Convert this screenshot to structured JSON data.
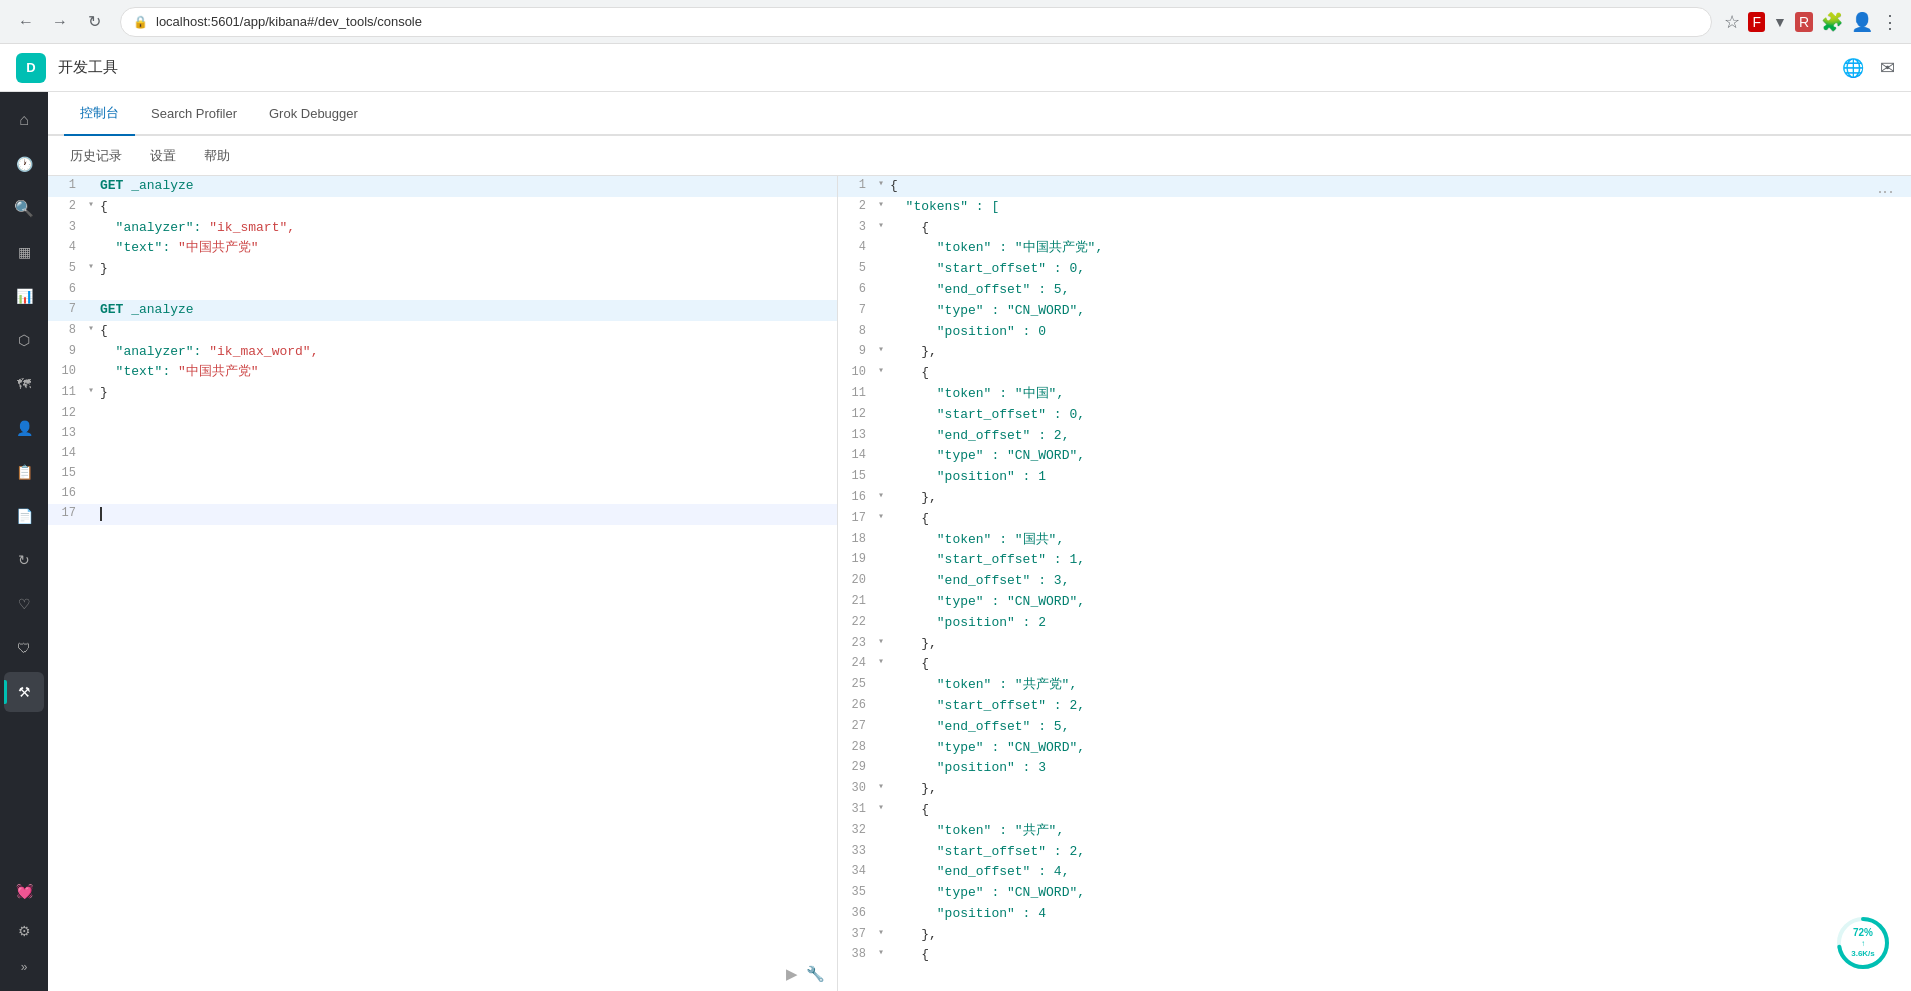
{
  "browser": {
    "url": "localhost:5601/app/kibana#/dev_tools/console",
    "nav_back": "←",
    "nav_forward": "→",
    "nav_refresh": "↻"
  },
  "appbar": {
    "logo_text": "D",
    "title": "开发工具"
  },
  "tabs": [
    {
      "id": "console",
      "label": "控制台",
      "active": true
    },
    {
      "id": "search-profiler",
      "label": "Search Profiler",
      "active": false
    },
    {
      "id": "grok-debugger",
      "label": "Grok Debugger",
      "active": false
    }
  ],
  "toolbar": {
    "history": "历史记录",
    "settings": "设置",
    "help": "帮助"
  },
  "left_editor": {
    "lines": [
      {
        "num": 1,
        "arrow": "",
        "code": "GET _analyze",
        "class": "green"
      },
      {
        "num": 2,
        "arrow": "▾",
        "code": "{",
        "class": ""
      },
      {
        "num": 3,
        "arrow": "",
        "code": "  \"analyzer\": \"ik_smart\",",
        "class": "mixed"
      },
      {
        "num": 4,
        "arrow": "",
        "code": "  \"text\": \"中国共产党\"",
        "class": "mixed"
      },
      {
        "num": 5,
        "arrow": "▾",
        "code": "}",
        "class": ""
      },
      {
        "num": 6,
        "arrow": "",
        "code": "",
        "class": ""
      },
      {
        "num": 7,
        "arrow": "",
        "code": "GET _analyze",
        "class": "green"
      },
      {
        "num": 8,
        "arrow": "▾",
        "code": "{",
        "class": ""
      },
      {
        "num": 9,
        "arrow": "",
        "code": "  \"analyzer\": \"ik_max_word\",",
        "class": "mixed"
      },
      {
        "num": 10,
        "arrow": "",
        "code": "  \"text\": \"中国共产党\"",
        "class": "mixed"
      },
      {
        "num": 11,
        "arrow": "▾",
        "code": "}",
        "class": ""
      },
      {
        "num": 12,
        "arrow": "",
        "code": "",
        "class": ""
      },
      {
        "num": 13,
        "arrow": "",
        "code": "",
        "class": ""
      },
      {
        "num": 14,
        "arrow": "",
        "code": "",
        "class": ""
      },
      {
        "num": 15,
        "arrow": "",
        "code": "",
        "class": ""
      },
      {
        "num": 16,
        "arrow": "",
        "code": "",
        "class": ""
      },
      {
        "num": 17,
        "arrow": "",
        "code": "",
        "class": "cursor"
      }
    ],
    "action_run": "▶",
    "action_wrench": "🔧"
  },
  "right_panel": {
    "lines": [
      {
        "num": 1,
        "arrow": "▾",
        "highlighted": true,
        "parts": [
          {
            "text": "{",
            "color": "#333"
          }
        ]
      },
      {
        "num": 2,
        "arrow": "▾",
        "parts": [
          {
            "text": "  \"tokens\" : [",
            "color": "#007f6e"
          }
        ]
      },
      {
        "num": 3,
        "arrow": "▾",
        "parts": [
          {
            "text": "    {",
            "color": "#333"
          }
        ]
      },
      {
        "num": 4,
        "arrow": "",
        "parts": [
          {
            "text": "      \"token\" : \"中国共产党\",",
            "color": "#007f6e"
          }
        ]
      },
      {
        "num": 5,
        "arrow": "",
        "parts": [
          {
            "text": "      \"start_offset\" : 0,",
            "color": "#007f6e"
          }
        ]
      },
      {
        "num": 6,
        "arrow": "",
        "parts": [
          {
            "text": "      \"end_offset\" : 5,",
            "color": "#007f6e"
          }
        ]
      },
      {
        "num": 7,
        "arrow": "",
        "parts": [
          {
            "text": "      \"type\" : \"CN_WORD\",",
            "color": "#007f6e"
          }
        ]
      },
      {
        "num": 8,
        "arrow": "",
        "parts": [
          {
            "text": "      \"position\" : 0",
            "color": "#007f6e"
          }
        ]
      },
      {
        "num": 9,
        "arrow": "▾",
        "parts": [
          {
            "text": "    },",
            "color": "#333"
          }
        ]
      },
      {
        "num": 10,
        "arrow": "▾",
        "parts": [
          {
            "text": "    {",
            "color": "#333"
          }
        ]
      },
      {
        "num": 11,
        "arrow": "",
        "parts": [
          {
            "text": "      \"token\" : \"中国\",",
            "color": "#007f6e"
          }
        ]
      },
      {
        "num": 12,
        "arrow": "",
        "parts": [
          {
            "text": "      \"start_offset\" : 0,",
            "color": "#007f6e"
          }
        ]
      },
      {
        "num": 13,
        "arrow": "",
        "parts": [
          {
            "text": "      \"end_offset\" : 2,",
            "color": "#007f6e"
          }
        ]
      },
      {
        "num": 14,
        "arrow": "",
        "parts": [
          {
            "text": "      \"type\" : \"CN_WORD\",",
            "color": "#007f6e"
          }
        ]
      },
      {
        "num": 15,
        "arrow": "",
        "parts": [
          {
            "text": "      \"position\" : 1",
            "color": "#007f6e"
          }
        ]
      },
      {
        "num": 16,
        "arrow": "▾",
        "parts": [
          {
            "text": "    },",
            "color": "#333"
          }
        ]
      },
      {
        "num": 17,
        "arrow": "▾",
        "parts": [
          {
            "text": "    {",
            "color": "#333"
          }
        ]
      },
      {
        "num": 18,
        "arrow": "",
        "parts": [
          {
            "text": "      \"token\" : \"国共\",",
            "color": "#007f6e"
          }
        ]
      },
      {
        "num": 19,
        "arrow": "",
        "parts": [
          {
            "text": "      \"start_offset\" : 1,",
            "color": "#007f6e"
          }
        ]
      },
      {
        "num": 20,
        "arrow": "",
        "parts": [
          {
            "text": "      \"end_offset\" : 3,",
            "color": "#007f6e"
          }
        ]
      },
      {
        "num": 21,
        "arrow": "",
        "parts": [
          {
            "text": "      \"type\" : \"CN_WORD\",",
            "color": "#007f6e"
          }
        ]
      },
      {
        "num": 22,
        "arrow": "",
        "parts": [
          {
            "text": "      \"position\" : 2",
            "color": "#007f6e"
          }
        ]
      },
      {
        "num": 23,
        "arrow": "▾",
        "parts": [
          {
            "text": "    },",
            "color": "#333"
          }
        ]
      },
      {
        "num": 24,
        "arrow": "▾",
        "parts": [
          {
            "text": "    {",
            "color": "#333"
          }
        ]
      },
      {
        "num": 25,
        "arrow": "",
        "parts": [
          {
            "text": "      \"token\" : \"共产党\",",
            "color": "#007f6e"
          }
        ]
      },
      {
        "num": 26,
        "arrow": "",
        "parts": [
          {
            "text": "      \"start_offset\" : 2,",
            "color": "#007f6e"
          }
        ]
      },
      {
        "num": 27,
        "arrow": "",
        "parts": [
          {
            "text": "      \"end_offset\" : 5,",
            "color": "#007f6e"
          }
        ]
      },
      {
        "num": 28,
        "arrow": "",
        "parts": [
          {
            "text": "      \"type\" : \"CN_WORD\",",
            "color": "#007f6e"
          }
        ]
      },
      {
        "num": 29,
        "arrow": "",
        "parts": [
          {
            "text": "      \"position\" : 3",
            "color": "#007f6e"
          }
        ]
      },
      {
        "num": 30,
        "arrow": "▾",
        "parts": [
          {
            "text": "    },",
            "color": "#333"
          }
        ]
      },
      {
        "num": 31,
        "arrow": "▾",
        "parts": [
          {
            "text": "    {",
            "color": "#333"
          }
        ]
      },
      {
        "num": 32,
        "arrow": "",
        "parts": [
          {
            "text": "      \"token\" : \"共产\",",
            "color": "#007f6e"
          }
        ]
      },
      {
        "num": 33,
        "arrow": "",
        "parts": [
          {
            "text": "      \"start_offset\" : 2,",
            "color": "#007f6e"
          }
        ]
      },
      {
        "num": 34,
        "arrow": "",
        "parts": [
          {
            "text": "      \"end_offset\" : 4,",
            "color": "#007f6e"
          }
        ]
      },
      {
        "num": 35,
        "arrow": "",
        "parts": [
          {
            "text": "      \"type\" : \"CN_WORD\",",
            "color": "#007f6e"
          }
        ]
      },
      {
        "num": 36,
        "arrow": "",
        "parts": [
          {
            "text": "      \"position\" : 4",
            "color": "#007f6e"
          }
        ]
      },
      {
        "num": 37,
        "arrow": "▾",
        "parts": [
          {
            "text": "    },",
            "color": "#333"
          }
        ]
      },
      {
        "num": 38,
        "arrow": "▾",
        "parts": [
          {
            "text": "    {",
            "color": "#333"
          }
        ]
      }
    ]
  },
  "sidebar": {
    "icons": [
      {
        "id": "home",
        "glyph": "🏠",
        "tooltip": "Home"
      },
      {
        "id": "clock",
        "glyph": "🕐",
        "tooltip": "Recent"
      },
      {
        "id": "discover",
        "glyph": "🔍",
        "tooltip": "Discover"
      },
      {
        "id": "dashboard",
        "glyph": "📊",
        "tooltip": "Dashboard"
      },
      {
        "id": "visualize",
        "glyph": "📈",
        "tooltip": "Visualize"
      },
      {
        "id": "canvas",
        "glyph": "🗂",
        "tooltip": "Canvas"
      },
      {
        "id": "maps",
        "glyph": "🗺",
        "tooltip": "Maps"
      },
      {
        "id": "ml",
        "glyph": "👤",
        "tooltip": "ML"
      },
      {
        "id": "infrastructure",
        "glyph": "📋",
        "tooltip": "Infrastructure"
      },
      {
        "id": "logs",
        "glyph": "📄",
        "tooltip": "Logs"
      },
      {
        "id": "apm",
        "glyph": "🔄",
        "tooltip": "APM"
      },
      {
        "id": "uptime",
        "glyph": "🏥",
        "tooltip": "Uptime"
      },
      {
        "id": "siem",
        "glyph": "🛡",
        "tooltip": "SIEM"
      },
      {
        "id": "devtools",
        "glyph": "⚙",
        "tooltip": "DevTools",
        "active": true
      },
      {
        "id": "monitoring",
        "glyph": "💓",
        "tooltip": "Monitoring"
      },
      {
        "id": "settings",
        "glyph": "⚙",
        "tooltip": "Settings"
      }
    ]
  },
  "progress": {
    "percent": 72,
    "label": "72%",
    "sublabel": "↑ 3.6K/s",
    "color": "#00bfb3",
    "radius": 24,
    "circumference": 150.8
  }
}
